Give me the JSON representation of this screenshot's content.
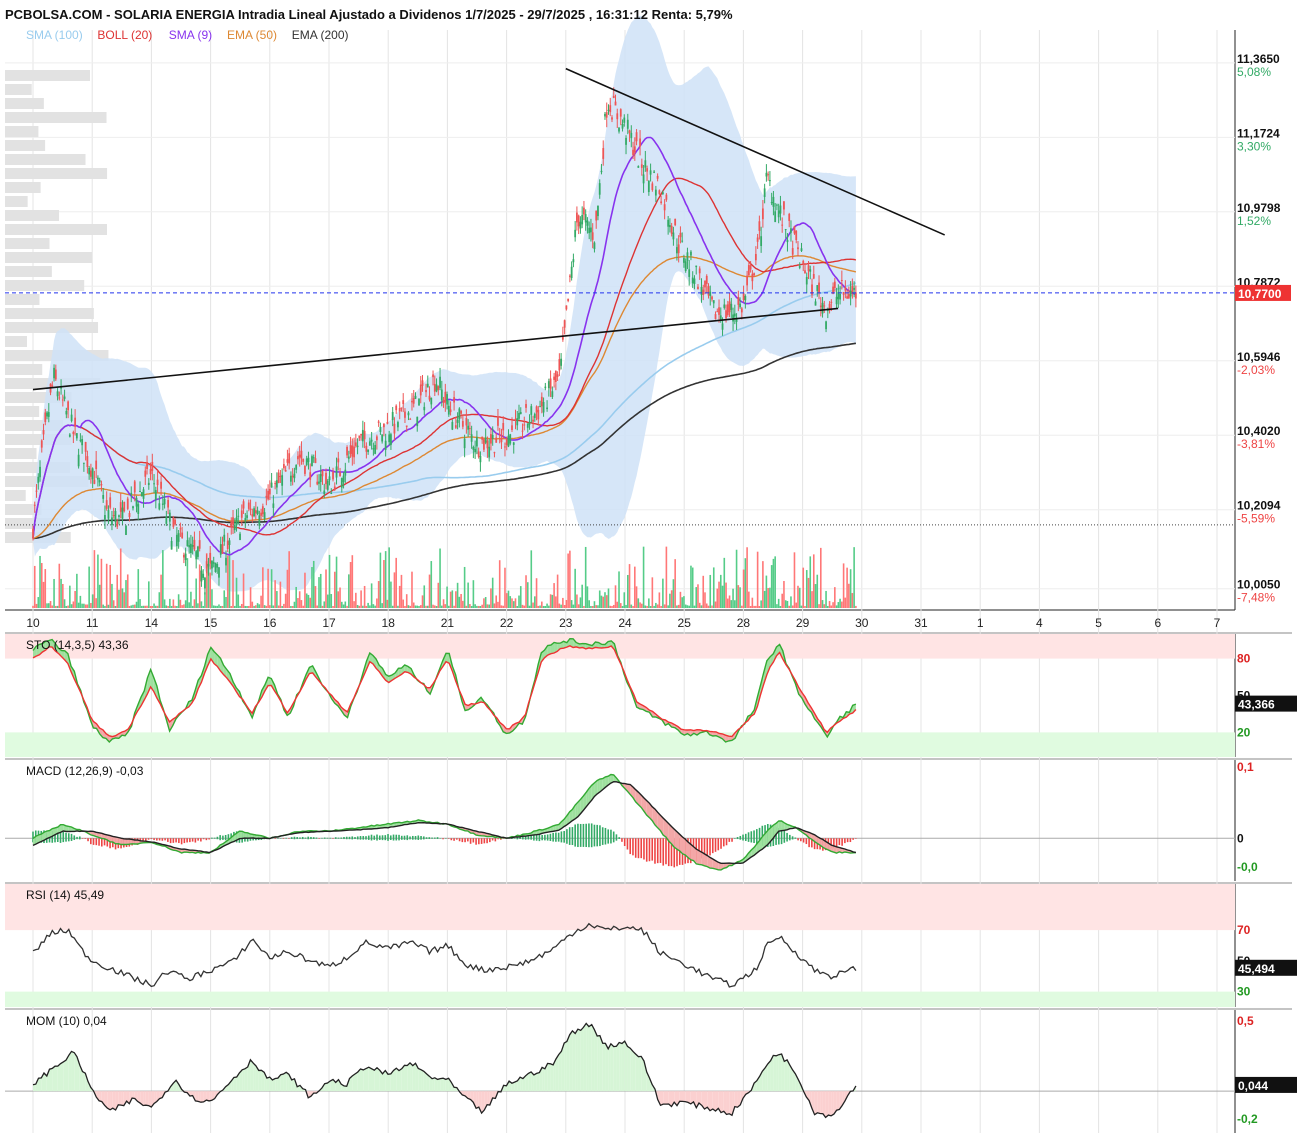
{
  "title": "PCBOLSA.COM - SOLARIA ENERGIA Intradia Lineal Ajustado a Dividenos 1/7/2025 - 29/7/2025 , 16:31:12 Renta: 5,79%",
  "legend": [
    {
      "label": "SMA (100)",
      "color": "#99ccee"
    },
    {
      "label": "BOLL (20)",
      "color": "#dd3333"
    },
    {
      "label": "SMA (9)",
      "color": "#8833ee"
    },
    {
      "label": "EMA (50)",
      "color": "#dd8833"
    },
    {
      "label": "EMA (200)",
      "color": "#333333"
    }
  ],
  "colors": {
    "up": "#33aa66",
    "down": "#ee5555",
    "band": "#cfe2f7",
    "sto_fast": "#33aa33",
    "sto_slow": "#ee3333"
  },
  "chart_data": [
    {
      "type": "candlestick",
      "price_labels": [
        {
          "value": "11,3650",
          "pct": "5,08%",
          "dir": "up"
        },
        {
          "value": "11,1724",
          "pct": "3,30%",
          "dir": "up"
        },
        {
          "value": "10,9798",
          "pct": "1,52%",
          "dir": "up"
        },
        {
          "value": "10,7872",
          "pct": "",
          "dir": "up"
        },
        {
          "value": "10,5946",
          "pct": "-2,03%",
          "dir": "down"
        },
        {
          "value": "10,4020",
          "pct": "-3,81%",
          "dir": "down"
        },
        {
          "value": "10,2094",
          "pct": "-5,59%",
          "dir": "down"
        },
        {
          "value": "10,0050",
          "pct": "-7,48%",
          "dir": "down"
        }
      ],
      "ylim": [
        9.95,
        11.45
      ],
      "last_price": "10,7700",
      "last_price_value": 10.77,
      "reference_price": 10.17,
      "x_ticks": [
        "10",
        "11",
        "14",
        "15",
        "16",
        "17",
        "18",
        "21",
        "22",
        "23",
        "24",
        "25",
        "28",
        "29",
        "30",
        "31",
        "1",
        "4",
        "5",
        "6",
        "7"
      ],
      "trendlines": [
        {
          "x": [
            "10",
            "29.6"
          ],
          "y": [
            10.52,
            10.73
          ]
        },
        {
          "x": [
            "23",
            "31.4"
          ],
          "y": [
            11.35,
            10.92
          ]
        }
      ],
      "close_anchors": [
        [
          0,
          10.17
        ],
        [
          0.2,
          10.4
        ],
        [
          0.35,
          10.55
        ],
        [
          0.7,
          10.4
        ],
        [
          1.0,
          10.32
        ],
        [
          1.25,
          10.2
        ],
        [
          1.5,
          10.18
        ],
        [
          2.0,
          10.3
        ],
        [
          2.4,
          10.14
        ],
        [
          3.0,
          10.05
        ],
        [
          3.5,
          10.18
        ],
        [
          4.0,
          10.24
        ],
        [
          4.5,
          10.35
        ],
        [
          5.0,
          10.27
        ],
        [
          5.5,
          10.38
        ],
        [
          6.0,
          10.42
        ],
        [
          6.5,
          10.48
        ],
        [
          6.8,
          10.55
        ],
        [
          7.0,
          10.48
        ],
        [
          7.5,
          10.38
        ],
        [
          8.0,
          10.4
        ],
        [
          8.5,
          10.46
        ],
        [
          8.9,
          10.55
        ],
        [
          9.2,
          10.97
        ],
        [
          9.5,
          10.92
        ],
        [
          9.7,
          11.27
        ],
        [
          10.0,
          11.2
        ],
        [
          10.3,
          11.1
        ],
        [
          10.6,
          11.04
        ],
        [
          10.9,
          10.9
        ],
        [
          11.2,
          10.82
        ],
        [
          11.5,
          10.72
        ],
        [
          11.8,
          10.72
        ],
        [
          12.0,
          10.74
        ],
        [
          12.25,
          10.88
        ],
        [
          12.4,
          11.07
        ],
        [
          12.6,
          10.98
        ],
        [
          12.9,
          10.88
        ],
        [
          13.2,
          10.78
        ],
        [
          13.4,
          10.73
        ],
        [
          13.6,
          10.77
        ]
      ],
      "volume_ticks": [
        10000,
        20000
      ]
    },
    {
      "type": "line",
      "name_label": "STO (14,3,5)",
      "value": "43,36",
      "last_tag": "43,366",
      "levels": [
        {
          "label": "80",
          "dir": "down"
        },
        {
          "label": "50",
          "dir": "neutral"
        },
        {
          "label": "20",
          "dir": "up"
        }
      ],
      "ylim": [
        0,
        100
      ],
      "fast_anchors": [
        [
          0,
          88
        ],
        [
          0.3,
          95
        ],
        [
          0.6,
          82
        ],
        [
          1.0,
          25
        ],
        [
          1.3,
          12
        ],
        [
          1.6,
          18
        ],
        [
          2.0,
          72
        ],
        [
          2.3,
          22
        ],
        [
          2.7,
          48
        ],
        [
          3.0,
          90
        ],
        [
          3.3,
          70
        ],
        [
          3.7,
          33
        ],
        [
          4.0,
          68
        ],
        [
          4.3,
          32
        ],
        [
          4.7,
          76
        ],
        [
          5.0,
          50
        ],
        [
          5.3,
          32
        ],
        [
          5.7,
          85
        ],
        [
          6.0,
          65
        ],
        [
          6.3,
          75
        ],
        [
          6.7,
          52
        ],
        [
          7.0,
          88
        ],
        [
          7.3,
          38
        ],
        [
          7.6,
          48
        ],
        [
          8.0,
          18
        ],
        [
          8.3,
          30
        ],
        [
          8.6,
          88
        ],
        [
          9.0,
          95
        ],
        [
          9.4,
          92
        ],
        [
          9.8,
          94
        ],
        [
          10.2,
          40
        ],
        [
          10.6,
          30
        ],
        [
          11.0,
          18
        ],
        [
          11.4,
          20
        ],
        [
          11.8,
          12
        ],
        [
          12.2,
          40
        ],
        [
          12.4,
          78
        ],
        [
          12.6,
          93
        ],
        [
          12.9,
          55
        ],
        [
          13.2,
          32
        ],
        [
          13.4,
          16
        ],
        [
          13.6,
          30
        ],
        [
          13.9,
          43
        ]
      ],
      "slow_anchors": [
        [
          0,
          80
        ],
        [
          0.3,
          90
        ],
        [
          0.6,
          75
        ],
        [
          1.0,
          30
        ],
        [
          1.3,
          16
        ],
        [
          1.6,
          22
        ],
        [
          2.0,
          58
        ],
        [
          2.3,
          28
        ],
        [
          2.7,
          44
        ],
        [
          3.0,
          80
        ],
        [
          3.3,
          62
        ],
        [
          3.7,
          36
        ],
        [
          4.0,
          60
        ],
        [
          4.3,
          36
        ],
        [
          4.7,
          70
        ],
        [
          5.0,
          52
        ],
        [
          5.3,
          36
        ],
        [
          5.7,
          78
        ],
        [
          6.0,
          60
        ],
        [
          6.3,
          70
        ],
        [
          6.7,
          55
        ],
        [
          7.0,
          80
        ],
        [
          7.3,
          42
        ],
        [
          7.6,
          45
        ],
        [
          8.0,
          22
        ],
        [
          8.3,
          32
        ],
        [
          8.6,
          80
        ],
        [
          9.0,
          90
        ],
        [
          9.4,
          88
        ],
        [
          9.8,
          90
        ],
        [
          10.2,
          45
        ],
        [
          10.6,
          32
        ],
        [
          11.0,
          22
        ],
        [
          11.4,
          22
        ],
        [
          11.8,
          16
        ],
        [
          12.2,
          36
        ],
        [
          12.4,
          68
        ],
        [
          12.6,
          86
        ],
        [
          12.9,
          60
        ],
        [
          13.2,
          36
        ],
        [
          13.4,
          20
        ],
        [
          13.6,
          28
        ],
        [
          13.9,
          38
        ]
      ]
    },
    {
      "type": "line",
      "name_label": "MACD (12,26,9)",
      "value": "-0,03",
      "levels": [
        {
          "label": "0,1",
          "dir": "down"
        },
        {
          "label": "0",
          "dir": "neutral"
        },
        {
          "label": "-0,0",
          "dir": "up"
        }
      ],
      "ylim": [
        -0.06,
        0.11
      ],
      "macd_anchors": [
        [
          0,
          0.0
        ],
        [
          0.5,
          0.02
        ],
        [
          1.0,
          0.005
        ],
        [
          1.5,
          -0.01
        ],
        [
          2.0,
          -0.005
        ],
        [
          2.5,
          -0.02
        ],
        [
          3.0,
          -0.02
        ],
        [
          3.5,
          0.01
        ],
        [
          4.0,
          0.0
        ],
        [
          4.5,
          0.01
        ],
        [
          5.0,
          0.01
        ],
        [
          5.5,
          0.015
        ],
        [
          6.0,
          0.02
        ],
        [
          6.5,
          0.025
        ],
        [
          7.0,
          0.02
        ],
        [
          7.5,
          0.005
        ],
        [
          8.0,
          0.0
        ],
        [
          8.5,
          0.01
        ],
        [
          8.9,
          0.02
        ],
        [
          9.2,
          0.05
        ],
        [
          9.5,
          0.08
        ],
        [
          9.8,
          0.09
        ],
        [
          10.1,
          0.06
        ],
        [
          10.4,
          0.03
        ],
        [
          10.8,
          -0.01
        ],
        [
          11.2,
          -0.035
        ],
        [
          11.6,
          -0.045
        ],
        [
          12.0,
          -0.03
        ],
        [
          12.4,
          0.01
        ],
        [
          12.6,
          0.025
        ],
        [
          12.9,
          0.015
        ],
        [
          13.2,
          -0.005
        ],
        [
          13.5,
          -0.02
        ],
        [
          13.9,
          -0.02
        ]
      ],
      "signal_anchors": [
        [
          0,
          -0.01
        ],
        [
          0.5,
          0.01
        ],
        [
          1.0,
          0.01
        ],
        [
          1.5,
          0.0
        ],
        [
          2.0,
          -0.005
        ],
        [
          2.5,
          -0.015
        ],
        [
          3.0,
          -0.02
        ],
        [
          3.5,
          0.0
        ],
        [
          4.0,
          0.0
        ],
        [
          4.5,
          0.008
        ],
        [
          5.0,
          0.01
        ],
        [
          5.5,
          0.012
        ],
        [
          6.0,
          0.015
        ],
        [
          6.5,
          0.022
        ],
        [
          7.0,
          0.02
        ],
        [
          7.5,
          0.01
        ],
        [
          8.0,
          0.0
        ],
        [
          8.5,
          0.005
        ],
        [
          8.9,
          0.012
        ],
        [
          9.2,
          0.03
        ],
        [
          9.5,
          0.06
        ],
        [
          9.8,
          0.08
        ],
        [
          10.1,
          0.075
        ],
        [
          10.4,
          0.05
        ],
        [
          10.8,
          0.015
        ],
        [
          11.2,
          -0.015
        ],
        [
          11.6,
          -0.035
        ],
        [
          12.0,
          -0.035
        ],
        [
          12.4,
          -0.01
        ],
        [
          12.6,
          0.01
        ],
        [
          12.9,
          0.015
        ],
        [
          13.2,
          0.005
        ],
        [
          13.5,
          -0.01
        ],
        [
          13.9,
          -0.02
        ]
      ]
    },
    {
      "type": "line",
      "name_label": "RSI (14)",
      "value": "45,49",
      "last_tag": "45,494",
      "levels": [
        {
          "label": "70",
          "dir": "down"
        },
        {
          "label": "50",
          "dir": "neutral"
        },
        {
          "label": "30",
          "dir": "up"
        }
      ],
      "ylim": [
        20,
        100
      ],
      "anchors": [
        [
          0,
          55
        ],
        [
          0.3,
          68
        ],
        [
          0.6,
          70
        ],
        [
          0.8,
          58
        ],
        [
          1.0,
          50
        ],
        [
          1.5,
          42
        ],
        [
          2.0,
          34
        ],
        [
          2.3,
          44
        ],
        [
          2.6,
          38
        ],
        [
          3.0,
          44
        ],
        [
          3.4,
          50
        ],
        [
          3.7,
          64
        ],
        [
          4.0,
          52
        ],
        [
          4.3,
          56
        ],
        [
          4.7,
          50
        ],
        [
          5.0,
          46
        ],
        [
          5.3,
          52
        ],
        [
          5.6,
          62
        ],
        [
          6.0,
          58
        ],
        [
          6.4,
          62
        ],
        [
          6.7,
          56
        ],
        [
          7.0,
          60
        ],
        [
          7.3,
          48
        ],
        [
          7.6,
          44
        ],
        [
          8.0,
          46
        ],
        [
          8.4,
          50
        ],
        [
          8.8,
          58
        ],
        [
          9.1,
          68
        ],
        [
          9.4,
          74
        ],
        [
          9.7,
          70
        ],
        [
          10.0,
          72
        ],
        [
          10.3,
          70
        ],
        [
          10.6,
          55
        ],
        [
          11.0,
          48
        ],
        [
          11.4,
          40
        ],
        [
          11.8,
          34
        ],
        [
          12.2,
          44
        ],
        [
          12.4,
          60
        ],
        [
          12.6,
          66
        ],
        [
          12.9,
          55
        ],
        [
          13.2,
          44
        ],
        [
          13.5,
          40
        ],
        [
          13.9,
          45
        ]
      ]
    },
    {
      "type": "line",
      "name_label": "MOM (10)",
      "value": "0,04",
      "last_tag": "0,044",
      "levels": [
        {
          "label": "0,5",
          "dir": "down"
        },
        {
          "label": "-0,2",
          "dir": "up"
        }
      ],
      "ylim": [
        -0.3,
        0.58
      ],
      "anchors": [
        [
          0,
          0.05
        ],
        [
          0.3,
          0.15
        ],
        [
          0.7,
          0.28
        ],
        [
          1.0,
          0.0
        ],
        [
          1.3,
          -0.15
        ],
        [
          1.7,
          -0.06
        ],
        [
          2.0,
          -0.12
        ],
        [
          2.4,
          0.08
        ],
        [
          2.7,
          -0.05
        ],
        [
          3.0,
          -0.08
        ],
        [
          3.4,
          0.1
        ],
        [
          3.7,
          0.22
        ],
        [
          4.0,
          0.08
        ],
        [
          4.3,
          0.12
        ],
        [
          4.7,
          -0.05
        ],
        [
          5.0,
          0.08
        ],
        [
          5.3,
          0.05
        ],
        [
          5.6,
          0.18
        ],
        [
          6.0,
          0.12
        ],
        [
          6.4,
          0.2
        ],
        [
          6.7,
          0.1
        ],
        [
          7.0,
          0.08
        ],
        [
          7.3,
          -0.05
        ],
        [
          7.6,
          -0.15
        ],
        [
          8.0,
          0.05
        ],
        [
          8.4,
          0.12
        ],
        [
          8.8,
          0.2
        ],
        [
          9.1,
          0.42
        ],
        [
          9.4,
          0.48
        ],
        [
          9.7,
          0.32
        ],
        [
          10.0,
          0.35
        ],
        [
          10.3,
          0.22
        ],
        [
          10.6,
          -0.1
        ],
        [
          11.0,
          -0.08
        ],
        [
          11.4,
          -0.12
        ],
        [
          11.8,
          -0.16
        ],
        [
          12.2,
          0.05
        ],
        [
          12.4,
          0.2
        ],
        [
          12.6,
          0.28
        ],
        [
          12.9,
          0.12
        ],
        [
          13.2,
          -0.15
        ],
        [
          13.5,
          -0.18
        ],
        [
          13.9,
          0.04
        ]
      ]
    }
  ]
}
